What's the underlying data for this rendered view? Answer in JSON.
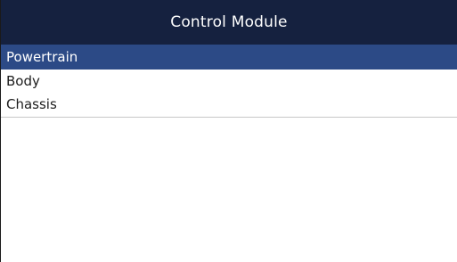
{
  "header": {
    "title": "Control Module"
  },
  "menu": {
    "items": [
      {
        "label": "Powertrain",
        "selected": true
      },
      {
        "label": "Body",
        "selected": false
      },
      {
        "label": "Chassis",
        "selected": false
      }
    ]
  },
  "colors": {
    "header_bg": "#15213f",
    "selected_bg": "#2c4a86",
    "text": "#1c1c1c"
  }
}
